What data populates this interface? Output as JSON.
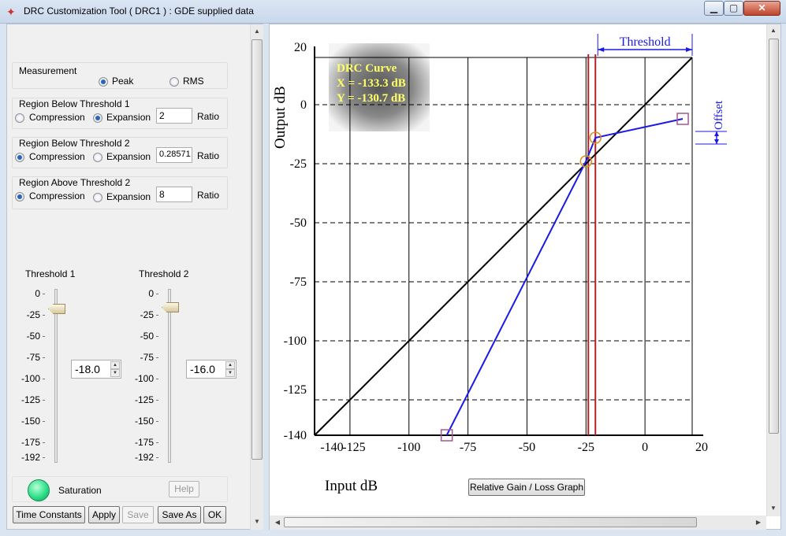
{
  "window": {
    "title": "DRC Customization Tool ( DRC1 ) :  GDE supplied data",
    "icon": "ti-logo-icon"
  },
  "measurement": {
    "label": "Measurement",
    "options": [
      "Peak",
      "RMS"
    ],
    "selected": "Peak"
  },
  "region_below_1": {
    "label": "Region Below Threshold 1",
    "options": [
      "Compression",
      "Expansion"
    ],
    "selected": "Expansion",
    "ratio_value": "2",
    "ratio_label": "Ratio"
  },
  "region_below_2": {
    "label": "Region Below Threshold 2",
    "options": [
      "Compression",
      "Expansion"
    ],
    "selected": "Compression",
    "ratio_value": "0.28571",
    "ratio_label": "Ratio"
  },
  "region_above_2": {
    "label": "Region Above Threshold 2",
    "options": [
      "Compression",
      "Expansion"
    ],
    "selected": "Compression",
    "ratio_value": "8",
    "ratio_label": "Ratio"
  },
  "threshold1": {
    "label": "Threshold 1",
    "value": "-18.0"
  },
  "threshold2": {
    "label": "Threshold 2",
    "value": "-16.0"
  },
  "slider_ticks": [
    "0",
    "-25",
    "-50",
    "-75",
    "-100",
    "-125",
    "-150",
    "-175",
    "-192"
  ],
  "saturation_label": "Saturation",
  "help_label": "Help",
  "buttons": {
    "time_constants": "Time Constants",
    "apply": "Apply",
    "save": "Save",
    "save_as": "Save As",
    "ok": "OK"
  },
  "chart_data": {
    "type": "line",
    "title": "",
    "xlabel": "Input dB",
    "ylabel": "Output dB",
    "x_ticks": [
      "-140",
      "-125",
      "-100",
      "-75",
      "-50",
      "-25",
      "0",
      "20"
    ],
    "y_ticks": [
      "20",
      "0",
      "-25",
      "-50",
      "-75",
      "-100",
      "-125",
      "-140"
    ],
    "xlim": [
      -140,
      20
    ],
    "ylim": [
      -140,
      20
    ],
    "series": [
      {
        "points": [
          [
            -140,
            -140
          ],
          [
            20,
            20
          ]
        ],
        "color": "#000000"
      },
      {
        "points": [
          [
            -84,
            -140
          ],
          [
            -25,
            -24
          ],
          [
            -21,
            -14
          ],
          [
            16,
            -6
          ]
        ],
        "color": "#1a1ae6"
      }
    ],
    "threshold_lines_x": [
      -24,
      -21
    ],
    "threshold_color": "#b22222",
    "threshold_label": "Threshold",
    "offset_label": "Offset",
    "info_title": "DRC Curve",
    "info_x": "X = -133.3 dB",
    "info_y": "Y = -130.7 dB",
    "relative_button": "Relative Gain / Loss Graph"
  }
}
